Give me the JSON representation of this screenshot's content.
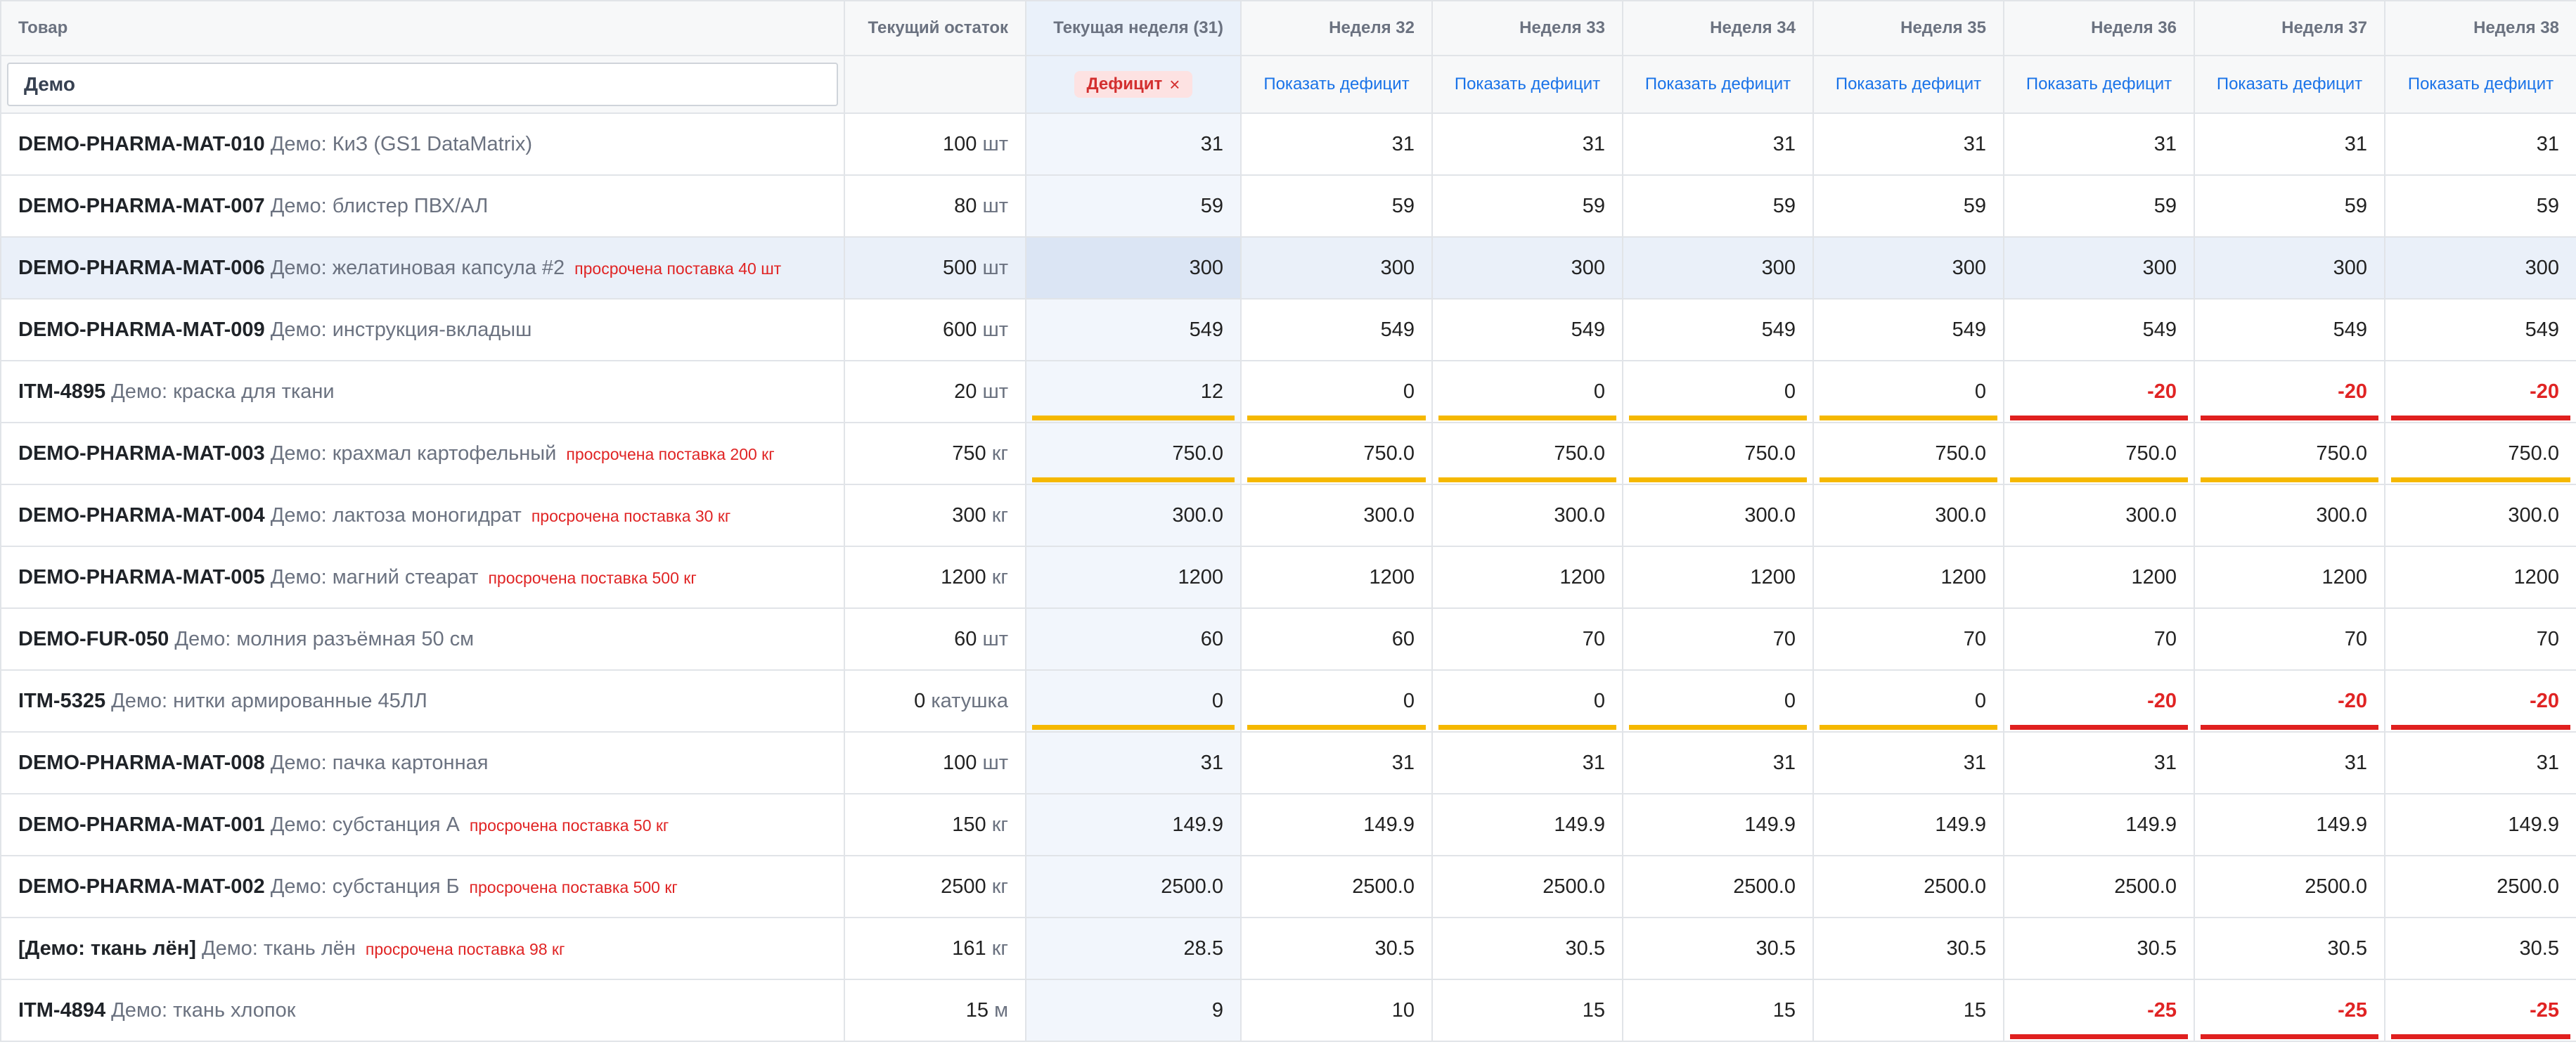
{
  "columns": {
    "product": "Товар",
    "stock": "Текущий остаток",
    "weeks": [
      "Текущая неделя (31)",
      "Неделя 32",
      "Неделя 33",
      "Неделя 34",
      "Неделя 35",
      "Неделя 36",
      "Неделя 37",
      "Неделя 38"
    ]
  },
  "filters": {
    "search_value": "Демо",
    "deficit_badge": "Дефицит",
    "deficit_clear": "×",
    "show_deficit": "Показать дефицит"
  },
  "status_colors": {
    "warning_bar": "#f5b800",
    "deficit_bar": "#e0201f",
    "negative_text": "#e02424",
    "link": "#1a73e8",
    "badge_bg": "#fde2e2"
  },
  "rows": [
    {
      "code": "DEMO-PHARMA-MAT-010",
      "name": "Демо: КиЗ (GS1 DataMatrix)",
      "overdue": "",
      "stock_qty": "100",
      "stock_unit": "шт",
      "highlighted": false,
      "weeks": [
        {
          "v": "31",
          "s": ""
        },
        {
          "v": "31",
          "s": ""
        },
        {
          "v": "31",
          "s": ""
        },
        {
          "v": "31",
          "s": ""
        },
        {
          "v": "31",
          "s": ""
        },
        {
          "v": "31",
          "s": ""
        },
        {
          "v": "31",
          "s": ""
        },
        {
          "v": "31",
          "s": ""
        }
      ]
    },
    {
      "code": "DEMO-PHARMA-MAT-007",
      "name": "Демо: блистер ПВХ/АЛ",
      "overdue": "",
      "stock_qty": "80",
      "stock_unit": "шт",
      "highlighted": false,
      "weeks": [
        {
          "v": "59",
          "s": ""
        },
        {
          "v": "59",
          "s": ""
        },
        {
          "v": "59",
          "s": ""
        },
        {
          "v": "59",
          "s": ""
        },
        {
          "v": "59",
          "s": ""
        },
        {
          "v": "59",
          "s": ""
        },
        {
          "v": "59",
          "s": ""
        },
        {
          "v": "59",
          "s": ""
        }
      ]
    },
    {
      "code": "DEMO-PHARMA-MAT-006",
      "name": "Демо: желатиновая капсула #2",
      "overdue": "просрочена поставка 40 шт",
      "stock_qty": "500",
      "stock_unit": "шт",
      "highlighted": true,
      "weeks": [
        {
          "v": "300",
          "s": ""
        },
        {
          "v": "300",
          "s": ""
        },
        {
          "v": "300",
          "s": ""
        },
        {
          "v": "300",
          "s": ""
        },
        {
          "v": "300",
          "s": ""
        },
        {
          "v": "300",
          "s": ""
        },
        {
          "v": "300",
          "s": ""
        },
        {
          "v": "300",
          "s": ""
        }
      ]
    },
    {
      "code": "DEMO-PHARMA-MAT-009",
      "name": "Демо: инструкция-вкладыш",
      "overdue": "",
      "stock_qty": "600",
      "stock_unit": "шт",
      "highlighted": false,
      "weeks": [
        {
          "v": "549",
          "s": ""
        },
        {
          "v": "549",
          "s": ""
        },
        {
          "v": "549",
          "s": ""
        },
        {
          "v": "549",
          "s": ""
        },
        {
          "v": "549",
          "s": ""
        },
        {
          "v": "549",
          "s": ""
        },
        {
          "v": "549",
          "s": ""
        },
        {
          "v": "549",
          "s": ""
        }
      ]
    },
    {
      "code": "ITM-4895",
      "name": "Демо: краска для ткани",
      "overdue": "",
      "stock_qty": "20",
      "stock_unit": "шт",
      "highlighted": false,
      "weeks": [
        {
          "v": "12",
          "s": "warning"
        },
        {
          "v": "0",
          "s": "warning"
        },
        {
          "v": "0",
          "s": "warning"
        },
        {
          "v": "0",
          "s": "warning"
        },
        {
          "v": "0",
          "s": "warning"
        },
        {
          "v": "-20",
          "s": "deficit"
        },
        {
          "v": "-20",
          "s": "deficit"
        },
        {
          "v": "-20",
          "s": "deficit"
        }
      ]
    },
    {
      "code": "DEMO-PHARMA-MAT-003",
      "name": "Демо: крахмал картофельный",
      "overdue": "просрочена поставка 200 кг",
      "stock_qty": "750",
      "stock_unit": "кг",
      "highlighted": false,
      "weeks": [
        {
          "v": "750.0",
          "s": "warning"
        },
        {
          "v": "750.0",
          "s": "warning"
        },
        {
          "v": "750.0",
          "s": "warning"
        },
        {
          "v": "750.0",
          "s": "warning"
        },
        {
          "v": "750.0",
          "s": "warning"
        },
        {
          "v": "750.0",
          "s": "warning"
        },
        {
          "v": "750.0",
          "s": "warning"
        },
        {
          "v": "750.0",
          "s": "warning"
        }
      ]
    },
    {
      "code": "DEMO-PHARMA-MAT-004",
      "name": "Демо: лактоза моногидрат",
      "overdue": "просрочена поставка 30 кг",
      "stock_qty": "300",
      "stock_unit": "кг",
      "highlighted": false,
      "weeks": [
        {
          "v": "300.0",
          "s": ""
        },
        {
          "v": "300.0",
          "s": ""
        },
        {
          "v": "300.0",
          "s": ""
        },
        {
          "v": "300.0",
          "s": ""
        },
        {
          "v": "300.0",
          "s": ""
        },
        {
          "v": "300.0",
          "s": ""
        },
        {
          "v": "300.0",
          "s": ""
        },
        {
          "v": "300.0",
          "s": ""
        }
      ]
    },
    {
      "code": "DEMO-PHARMA-MAT-005",
      "name": "Демо: магний стеарат",
      "overdue": "просрочена поставка 500 кг",
      "stock_qty": "1200",
      "stock_unit": "кг",
      "highlighted": false,
      "weeks": [
        {
          "v": "1200",
          "s": ""
        },
        {
          "v": "1200",
          "s": ""
        },
        {
          "v": "1200",
          "s": ""
        },
        {
          "v": "1200",
          "s": ""
        },
        {
          "v": "1200",
          "s": ""
        },
        {
          "v": "1200",
          "s": ""
        },
        {
          "v": "1200",
          "s": ""
        },
        {
          "v": "1200",
          "s": ""
        }
      ]
    },
    {
      "code": "DEMO-FUR-050",
      "name": "Демо: молния разъёмная 50 см",
      "overdue": "",
      "stock_qty": "60",
      "stock_unit": "шт",
      "highlighted": false,
      "weeks": [
        {
          "v": "60",
          "s": ""
        },
        {
          "v": "60",
          "s": ""
        },
        {
          "v": "70",
          "s": ""
        },
        {
          "v": "70",
          "s": ""
        },
        {
          "v": "70",
          "s": ""
        },
        {
          "v": "70",
          "s": ""
        },
        {
          "v": "70",
          "s": ""
        },
        {
          "v": "70",
          "s": ""
        }
      ]
    },
    {
      "code": "ITM-5325",
      "name": "Демо: нитки армированные 45ЛЛ",
      "overdue": "",
      "stock_qty": "0",
      "stock_unit": "катушка",
      "highlighted": false,
      "weeks": [
        {
          "v": "0",
          "s": "warning"
        },
        {
          "v": "0",
          "s": "warning"
        },
        {
          "v": "0",
          "s": "warning"
        },
        {
          "v": "0",
          "s": "warning"
        },
        {
          "v": "0",
          "s": "warning"
        },
        {
          "v": "-20",
          "s": "deficit"
        },
        {
          "v": "-20",
          "s": "deficit"
        },
        {
          "v": "-20",
          "s": "deficit"
        }
      ]
    },
    {
      "code": "DEMO-PHARMA-MAT-008",
      "name": "Демо: пачка картонная",
      "overdue": "",
      "stock_qty": "100",
      "stock_unit": "шт",
      "highlighted": false,
      "weeks": [
        {
          "v": "31",
          "s": ""
        },
        {
          "v": "31",
          "s": ""
        },
        {
          "v": "31",
          "s": ""
        },
        {
          "v": "31",
          "s": ""
        },
        {
          "v": "31",
          "s": ""
        },
        {
          "v": "31",
          "s": ""
        },
        {
          "v": "31",
          "s": ""
        },
        {
          "v": "31",
          "s": ""
        }
      ]
    },
    {
      "code": "DEMO-PHARMA-MAT-001",
      "name": "Демо: субстанция А",
      "overdue": "просрочена поставка 50 кг",
      "stock_qty": "150",
      "stock_unit": "кг",
      "highlighted": false,
      "weeks": [
        {
          "v": "149.9",
          "s": ""
        },
        {
          "v": "149.9",
          "s": ""
        },
        {
          "v": "149.9",
          "s": ""
        },
        {
          "v": "149.9",
          "s": ""
        },
        {
          "v": "149.9",
          "s": ""
        },
        {
          "v": "149.9",
          "s": ""
        },
        {
          "v": "149.9",
          "s": ""
        },
        {
          "v": "149.9",
          "s": ""
        }
      ]
    },
    {
      "code": "DEMO-PHARMA-MAT-002",
      "name": "Демо: субстанция Б",
      "overdue": "просрочена поставка 500 кг",
      "stock_qty": "2500",
      "stock_unit": "кг",
      "highlighted": false,
      "weeks": [
        {
          "v": "2500.0",
          "s": ""
        },
        {
          "v": "2500.0",
          "s": ""
        },
        {
          "v": "2500.0",
          "s": ""
        },
        {
          "v": "2500.0",
          "s": ""
        },
        {
          "v": "2500.0",
          "s": ""
        },
        {
          "v": "2500.0",
          "s": ""
        },
        {
          "v": "2500.0",
          "s": ""
        },
        {
          "v": "2500.0",
          "s": ""
        }
      ]
    },
    {
      "code": "[Демо: ткань лён]",
      "name": "Демо: ткань лён",
      "overdue": "просрочена поставка 98 кг",
      "stock_qty": "161",
      "stock_unit": "кг",
      "highlighted": false,
      "weeks": [
        {
          "v": "28.5",
          "s": ""
        },
        {
          "v": "30.5",
          "s": ""
        },
        {
          "v": "30.5",
          "s": ""
        },
        {
          "v": "30.5",
          "s": ""
        },
        {
          "v": "30.5",
          "s": ""
        },
        {
          "v": "30.5",
          "s": ""
        },
        {
          "v": "30.5",
          "s": ""
        },
        {
          "v": "30.5",
          "s": ""
        }
      ]
    },
    {
      "code": "ITM-4894",
      "name": "Демо: ткань хлопок",
      "overdue": "",
      "stock_qty": "15",
      "stock_unit": "м",
      "highlighted": false,
      "weeks": [
        {
          "v": "9",
          "s": ""
        },
        {
          "v": "10",
          "s": ""
        },
        {
          "v": "15",
          "s": ""
        },
        {
          "v": "15",
          "s": ""
        },
        {
          "v": "15",
          "s": ""
        },
        {
          "v": "-25",
          "s": "deficit"
        },
        {
          "v": "-25",
          "s": "deficit"
        },
        {
          "v": "-25",
          "s": "deficit"
        }
      ]
    }
  ]
}
